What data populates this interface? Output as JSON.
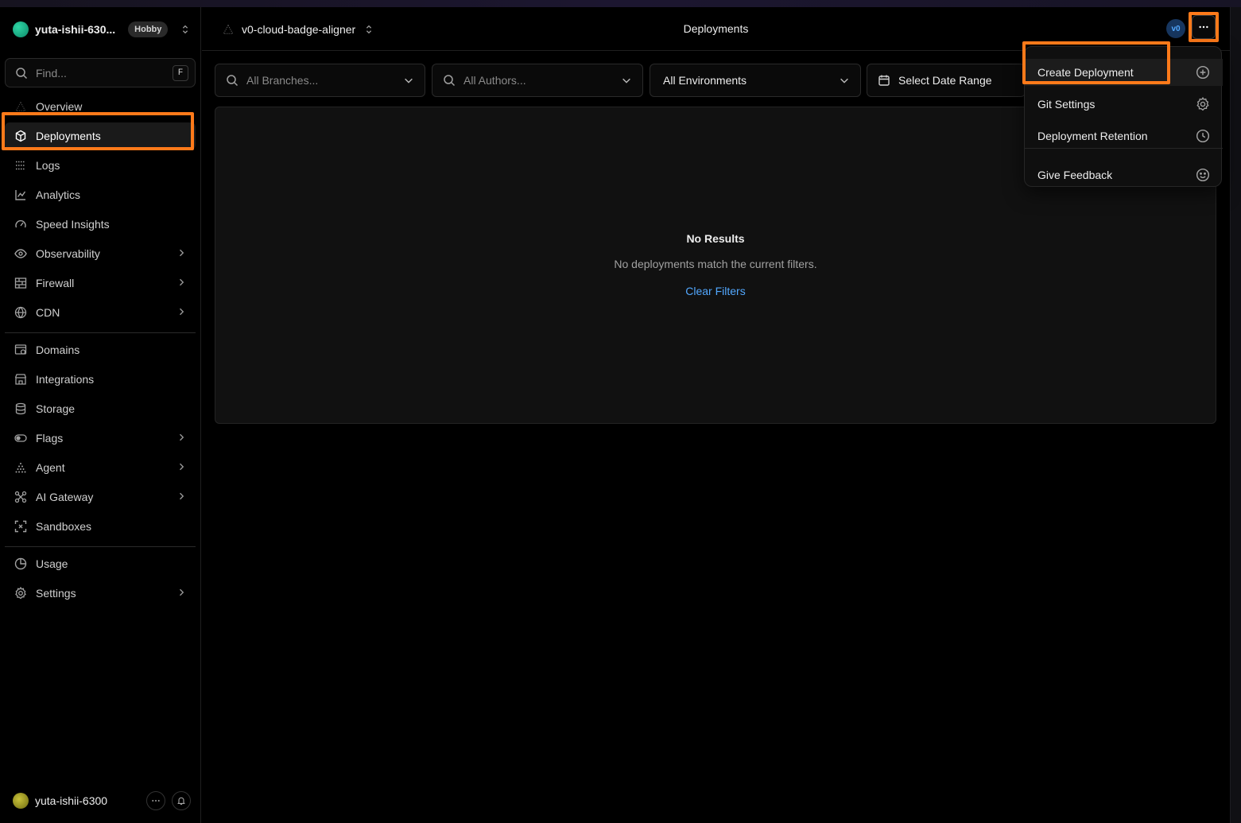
{
  "team": {
    "name": "yuta-ishii-630...",
    "plan": "Hobby"
  },
  "search": {
    "placeholder": "Find...",
    "shortcut": "F"
  },
  "sidebar": {
    "items": [
      {
        "label": "Overview",
        "icon": "vercel-triangle-icon"
      },
      {
        "label": "Deployments",
        "icon": "cube-icon",
        "active": true
      },
      {
        "label": "Logs",
        "icon": "list-icon"
      },
      {
        "label": "Analytics",
        "icon": "chart-line-icon"
      },
      {
        "label": "Speed Insights",
        "icon": "gauge-icon"
      },
      {
        "label": "Observability",
        "icon": "eye-icon",
        "expandable": true
      },
      {
        "label": "Firewall",
        "icon": "firewall-icon",
        "expandable": true
      },
      {
        "label": "CDN",
        "icon": "globe-icon",
        "expandable": true
      },
      {
        "label": "Domains",
        "icon": "domains-icon"
      },
      {
        "label": "Integrations",
        "icon": "store-icon"
      },
      {
        "label": "Storage",
        "icon": "database-icon"
      },
      {
        "label": "Flags",
        "icon": "toggle-icon",
        "expandable": true
      },
      {
        "label": "Agent",
        "icon": "agent-icon",
        "expandable": true
      },
      {
        "label": "AI Gateway",
        "icon": "gateway-icon",
        "expandable": true
      },
      {
        "label": "Sandboxes",
        "icon": "sandbox-icon"
      },
      {
        "label": "Usage",
        "icon": "pie-icon"
      },
      {
        "label": "Settings",
        "icon": "gear-icon",
        "expandable": true
      }
    ]
  },
  "user": {
    "name": "yuta-ishii-6300"
  },
  "header": {
    "project": "v0-cloud-badge-aligner",
    "title": "Deployments",
    "v0_label": "v0"
  },
  "filters": {
    "branches_placeholder": "All Branches...",
    "authors_placeholder": "All Authors...",
    "environment": "All Environments",
    "date_range": "Select Date Range"
  },
  "empty": {
    "title": "No Results",
    "description": "No deployments match the current filters.",
    "action": "Clear Filters"
  },
  "menu": {
    "items": [
      {
        "label": "Create Deployment",
        "icon": "plus-circle-icon"
      },
      {
        "label": "Git Settings",
        "icon": "gear-icon"
      },
      {
        "label": "Deployment Retention",
        "icon": "clock-icon"
      },
      {
        "label": "Give Feedback",
        "icon": "smiley-icon"
      }
    ]
  },
  "colors": {
    "highlight": "#ff7a1a",
    "link": "#52a8ff",
    "background": "#000000"
  }
}
